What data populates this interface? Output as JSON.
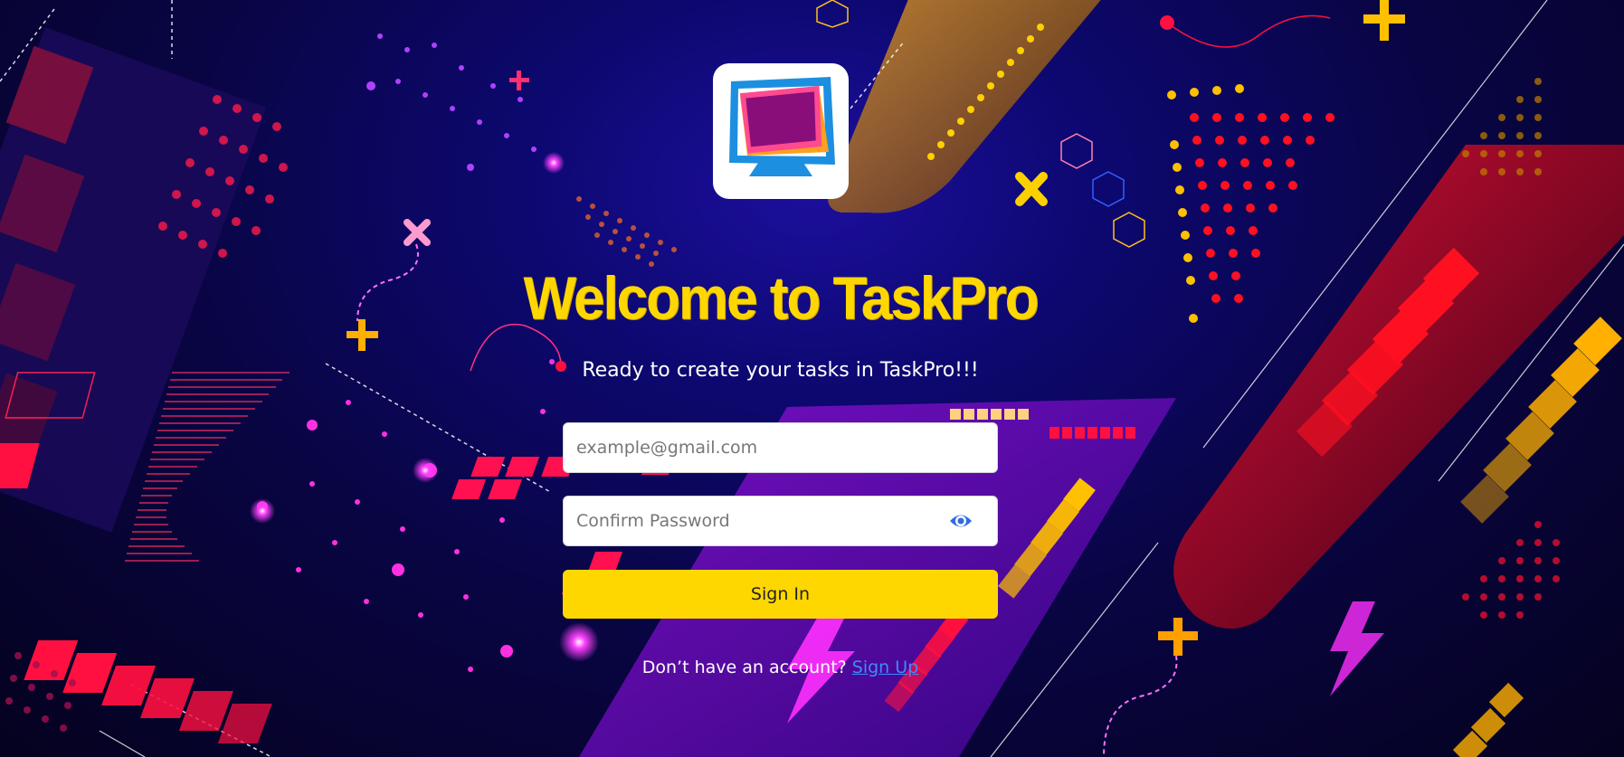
{
  "app": {
    "title": "Welcome to TaskPro",
    "subtitle": "Ready to create your tasks in TaskPro!!!"
  },
  "form": {
    "email_placeholder": "example@gmail.com",
    "password_placeholder": "Confirm Password",
    "submit_label": "Sign In"
  },
  "footer": {
    "prompt": "Don’t have an account? ",
    "link_label": "Sign Up"
  },
  "icons": {
    "logo": "taskpro-monitor-logo-icon",
    "password_toggle": "eye-icon"
  },
  "colors": {
    "accent": "#ffd700",
    "link": "#3d8bff",
    "background": "#0d0870"
  }
}
